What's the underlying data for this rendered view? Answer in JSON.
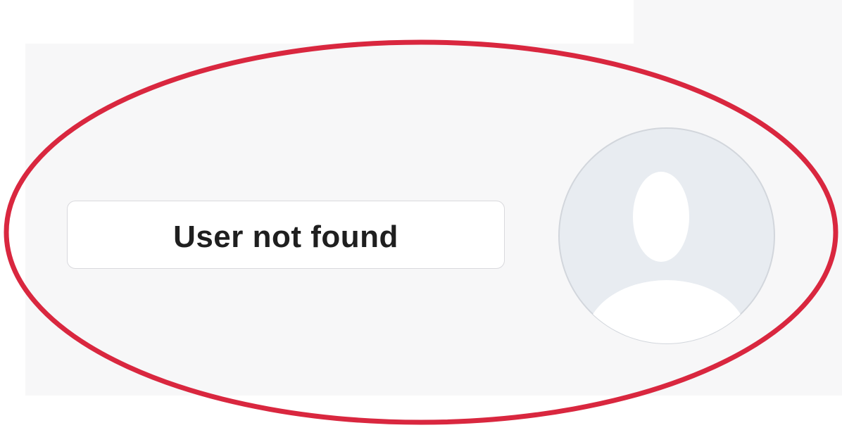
{
  "message": {
    "text": "User not found"
  },
  "avatar": {
    "icon": "default-user-avatar-icon",
    "background_color": "#e8ecf1",
    "silhouette_color": "#ffffff",
    "border_color": "#d2d6dc"
  },
  "highlight": {
    "shape": "ellipse",
    "color": "#d9273f"
  },
  "colors": {
    "page_background": "#ffffff",
    "panel_background": "#f7f7f8",
    "text": "#1f1f1f"
  }
}
